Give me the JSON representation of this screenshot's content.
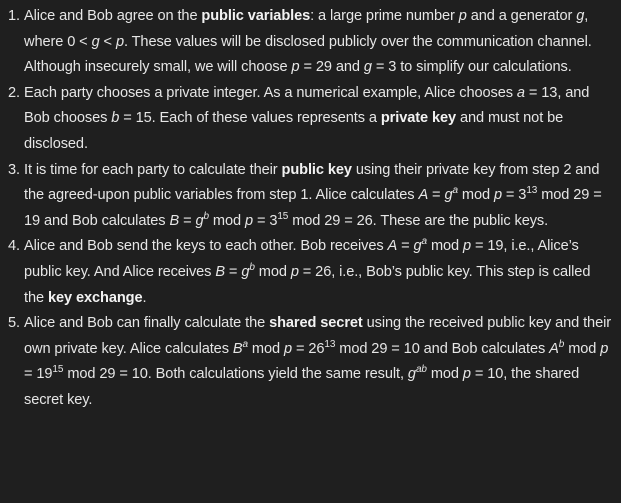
{
  "steps": [
    {
      "number": "1.",
      "parts": [
        {
          "t": "Alice and Bob agree on the "
        },
        {
          "t": "public variables",
          "b": true
        },
        {
          "t": ": a large prime number "
        },
        {
          "t": "p",
          "i": true
        },
        {
          "t": " and a generator "
        },
        {
          "t": "g",
          "i": true
        },
        {
          "t": ", where 0 < "
        },
        {
          "t": "g",
          "i": true
        },
        {
          "t": " < "
        },
        {
          "t": "p",
          "i": true
        },
        {
          "t": ". These values will be disclosed publicly over the communication channel. Although insecurely small, we will choose "
        },
        {
          "t": "p",
          "i": true
        },
        {
          "t": " = 29 and "
        },
        {
          "t": "g",
          "i": true
        },
        {
          "t": " = 3 to simplify our calculations."
        }
      ]
    },
    {
      "number": "2.",
      "parts": [
        {
          "t": "Each party chooses a private integer. As a numerical example, Alice chooses "
        },
        {
          "t": "a",
          "i": true
        },
        {
          "t": " = 13, and Bob chooses "
        },
        {
          "t": "b",
          "i": true
        },
        {
          "t": " = 15. Each of these values represents a "
        },
        {
          "t": "private key",
          "b": true
        },
        {
          "t": " and must not be disclosed."
        }
      ]
    },
    {
      "number": "3.",
      "parts": [
        {
          "t": "It is time for each party to calculate their "
        },
        {
          "t": "public key",
          "b": true
        },
        {
          "t": " using their private key from step 2 and the agreed-upon public variables from step 1. Alice calculates "
        },
        {
          "t": "A",
          "i": true
        },
        {
          "t": " = "
        },
        {
          "t": "g",
          "i": true
        },
        {
          "t": "a",
          "i": true,
          "sup": true
        },
        {
          "t": " mod "
        },
        {
          "t": "p",
          "i": true
        },
        {
          "t": " = 3"
        },
        {
          "t": "13",
          "sup": true
        },
        {
          "t": " mod 29 = 19 and Bob calculates "
        },
        {
          "t": "B",
          "i": true
        },
        {
          "t": " = "
        },
        {
          "t": "g",
          "i": true
        },
        {
          "t": "b",
          "i": true,
          "sup": true
        },
        {
          "t": " mod "
        },
        {
          "t": "p",
          "i": true
        },
        {
          "t": " = 3"
        },
        {
          "t": "15",
          "sup": true
        },
        {
          "t": " mod 29 = 26. These are the public keys."
        }
      ]
    },
    {
      "number": "4.",
      "parts": [
        {
          "t": "Alice and Bob send the keys to each other. Bob receives "
        },
        {
          "t": "A",
          "i": true
        },
        {
          "t": " = "
        },
        {
          "t": "g",
          "i": true
        },
        {
          "t": "a",
          "i": true,
          "sup": true
        },
        {
          "t": " mod "
        },
        {
          "t": "p",
          "i": true
        },
        {
          "t": " = 19, i.e., Alice’s public key. And Alice receives "
        },
        {
          "t": "B",
          "i": true
        },
        {
          "t": " = "
        },
        {
          "t": "g",
          "i": true
        },
        {
          "t": "b",
          "i": true,
          "sup": true
        },
        {
          "t": " mod "
        },
        {
          "t": "p",
          "i": true
        },
        {
          "t": " = 26, i.e., Bob’s public key. This step is called the "
        },
        {
          "t": "key exchange",
          "b": true
        },
        {
          "t": "."
        }
      ]
    },
    {
      "number": "5.",
      "parts": [
        {
          "t": "Alice and Bob can finally calculate the "
        },
        {
          "t": "shared secret",
          "b": true
        },
        {
          "t": " using the received public key and their own private key. Alice calculates "
        },
        {
          "t": "B",
          "i": true
        },
        {
          "t": "a",
          "i": true,
          "sup": true
        },
        {
          "t": " mod "
        },
        {
          "t": "p",
          "i": true
        },
        {
          "t": " = 26"
        },
        {
          "t": "13",
          "sup": true
        },
        {
          "t": " mod 29 = 10 and Bob calculates "
        },
        {
          "t": "A",
          "i": true
        },
        {
          "t": "b",
          "i": true,
          "sup": true
        },
        {
          "t": " mod "
        },
        {
          "t": "p",
          "i": true
        },
        {
          "t": " = 19"
        },
        {
          "t": "15",
          "sup": true
        },
        {
          "t": " mod 29 = 10. Both calculations yield the same result, "
        },
        {
          "t": "g",
          "i": true
        },
        {
          "t": "ab",
          "i": true,
          "sup": true
        },
        {
          "t": " mod "
        },
        {
          "t": "p",
          "i": true
        },
        {
          "t": " = 10, the shared secret key."
        }
      ]
    }
  ]
}
